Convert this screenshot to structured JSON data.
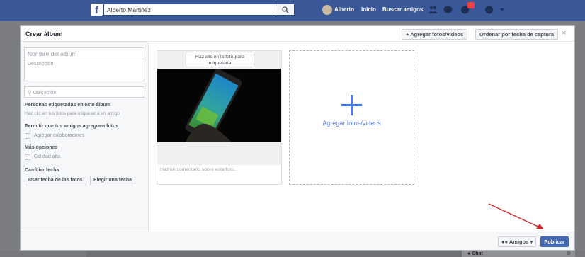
{
  "topbar": {
    "user_name": "Alberto Martinez",
    "nav": {
      "profile": "Alberto",
      "home": "Inicio",
      "find_friends": "Buscar amigos"
    }
  },
  "dialog": {
    "title": "Crear álbum",
    "add_photos_label": "Agregar fotos/videos",
    "sort_label": "Ordenar por fecha de captura",
    "close_label": "×"
  },
  "sidebar": {
    "album_name_placeholder": "Nombre del álbum",
    "description_placeholder": "Descripción",
    "location_placeholder": "Ubicación",
    "tagged_people_title": "Personas etiquetadas en este álbum",
    "tagged_people_hint": "Haz clic en tus fotos para etiquetar a un amigo",
    "friends_add_title": "Permitir que tus amigos agreguen fotos",
    "add_collaborators": "Agregar colaboradores",
    "more_options_title": "Más opciones",
    "high_quality": "Calidad alta",
    "change_date_title": "Cambiar fecha",
    "use_photo_dates": "Usar fecha de las fotos",
    "choose_date": "Elegir una fecha"
  },
  "content": {
    "tag_prompt": "Haz clic en la foto para etiquetarla",
    "comment_placeholder": "Haz un comentario sobre esta foto...",
    "add_tile_label": "Agregar fotos/videos"
  },
  "footer": {
    "audience_label": "Amigos",
    "publish_label": "Publicar"
  },
  "chat": {
    "label": "Chat"
  },
  "colors": {
    "brand": "#3b5998",
    "primary": "#4267b2",
    "accent": "#4080ff",
    "arrow": "#d0252b"
  }
}
